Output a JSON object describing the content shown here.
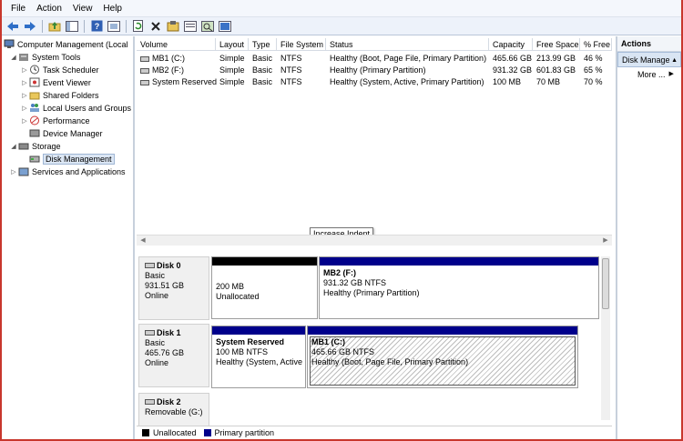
{
  "menu": [
    "File",
    "Action",
    "View",
    "Help"
  ],
  "toolbar": {
    "icons": [
      "back-icon",
      "forward-icon",
      "up-folder-icon",
      "show-hide-tree-icon",
      "help-icon",
      "properties-icon",
      "refresh-icon",
      "delete-icon",
      "settings-icon",
      "export-icon",
      "search-icon",
      "help-topic-icon"
    ]
  },
  "tree": {
    "root": "Computer Management (Local",
    "system_tools": "System Tools",
    "task_scheduler": "Task Scheduler",
    "event_viewer": "Event Viewer",
    "shared_folders": "Shared Folders",
    "local_users": "Local Users and Groups",
    "performance": "Performance",
    "device_manager": "Device Manager",
    "storage": "Storage",
    "disk_management": "Disk Management",
    "services": "Services and Applications"
  },
  "volumes": {
    "columns": [
      "Volume",
      "Layout",
      "Type",
      "File System",
      "Status",
      "Capacity",
      "Free Space",
      "% Free"
    ],
    "rows": [
      {
        "volume": "MB1 (C:)",
        "layout": "Simple",
        "type": "Basic",
        "fs": "NTFS",
        "status": "Healthy (Boot, Page File, Primary Partition)",
        "capacity": "465.66 GB",
        "free": "213.99 GB",
        "pct": "46 %"
      },
      {
        "volume": "MB2 (F:)",
        "layout": "Simple",
        "type": "Basic",
        "fs": "NTFS",
        "status": "Healthy (Primary Partition)",
        "capacity": "931.32 GB",
        "free": "601.83 GB",
        "pct": "65 %"
      },
      {
        "volume": "System Reserved",
        "layout": "Simple",
        "type": "Basic",
        "fs": "NTFS",
        "status": "Healthy (System, Active, Primary Partition)",
        "capacity": "100 MB",
        "free": "70 MB",
        "pct": "70 %"
      }
    ]
  },
  "tooltip": "Increase Indent",
  "disks": [
    {
      "name": "Disk 0",
      "type": "Basic",
      "size": "931.51 GB",
      "state": "Online",
      "parts": [
        {
          "title": "",
          "size": "200 MB",
          "status": "Unallocated"
        },
        {
          "title": "MB2  (F:)",
          "size": "931.32 GB NTFS",
          "status": "Healthy (Primary Partition)"
        }
      ]
    },
    {
      "name": "Disk 1",
      "type": "Basic",
      "size": "465.76 GB",
      "state": "Online",
      "parts": [
        {
          "title": "System Reserved",
          "size": "100 MB NTFS",
          "status": "Healthy (System, Active"
        },
        {
          "title": "MB1  (C:)",
          "size": "465.66 GB NTFS",
          "status": "Healthy (Boot, Page File, Primary Partition)"
        }
      ]
    },
    {
      "name": "Disk 2",
      "type": "Removable (G:)",
      "size": "",
      "state": "",
      "parts": []
    }
  ],
  "legend": {
    "unallocated": "Unallocated",
    "primary": "Primary partition"
  },
  "colors": {
    "primary": "#00008b",
    "unallocated": "#000000",
    "window_border": "#c8372d"
  },
  "actions": {
    "header": "Actions",
    "selected": "Disk Management",
    "more": "More ..."
  }
}
